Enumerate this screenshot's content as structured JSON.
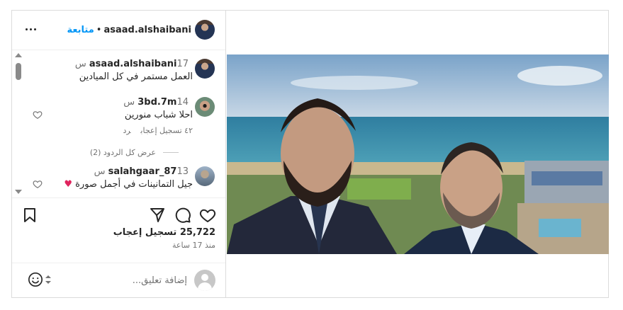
{
  "header": {
    "username": "asaad.alshaibani",
    "separator": "•",
    "follow_label": "متابعة",
    "more_icon": "more-horizontal-icon"
  },
  "comments": [
    {
      "username": "asaad.alshaibani",
      "time": "17 س",
      "text": "العمل مستمر في كل الميادين",
      "is_caption": true
    },
    {
      "username": "3bd.7m",
      "time": "14 س",
      "text": "احلا شباب منورين",
      "likes": "٤٢ تسجيل إعجاب",
      "reply_label": "رد"
    },
    {
      "view_replies": "عرض كل الردود (2)"
    },
    {
      "username": "salahgaar_87",
      "time": "13 س",
      "text": "جيل التمانينات في أجمل صورة",
      "emoji": "♥"
    }
  ],
  "actions": {
    "like_icon": "heart-icon",
    "comment_icon": "comment-icon",
    "share_icon": "send-icon",
    "save_icon": "bookmark-icon"
  },
  "likes_text": "25,722 تسجيل إعجاب",
  "time_ago": "منذ 17 ساعة",
  "add_comment": {
    "placeholder": "إضافة تعليق...",
    "emoji_icon": "smiley-icon"
  },
  "colors": {
    "accent": "#0095f6",
    "border": "#dbdbdb",
    "text": "#262626",
    "muted": "#737373",
    "heart_red": "#e0245e"
  }
}
